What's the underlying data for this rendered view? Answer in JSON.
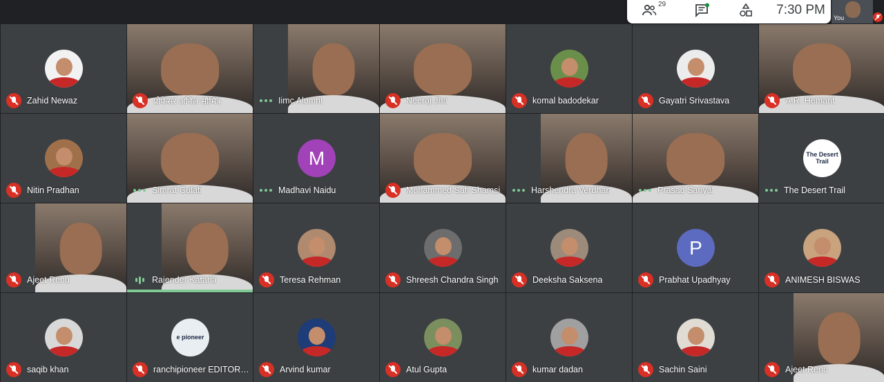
{
  "status_bar": {
    "participant_count": "29",
    "time": "7:30 PM",
    "self_label": "You"
  },
  "colors": {
    "background": "#202124",
    "tile": "#3c4043",
    "muted_red": "#d93025",
    "speaking_green": "#81c995"
  },
  "participants": [
    {
      "name": "Zahid Newaz",
      "mic": "muted",
      "kind": "avatar",
      "avatar_color": "#f2f2f2"
    },
    {
      "name": "प्रोफेसर अनिल सौमित्र",
      "mic": "muted",
      "kind": "video"
    },
    {
      "name": "Iimc Alumni",
      "mic": "connected",
      "kind": "video"
    },
    {
      "name": "Neeraj Jha",
      "mic": "muted",
      "kind": "video"
    },
    {
      "name": "komal badodekar",
      "mic": "muted",
      "kind": "avatar",
      "avatar_color": "#6a8f4a"
    },
    {
      "name": "Gayatri Srivastava",
      "mic": "muted",
      "kind": "avatar",
      "avatar_color": "#ececec"
    },
    {
      "name": "A.R. Hemant",
      "mic": "muted",
      "kind": "video"
    },
    {
      "name": "Nitin Pradhan",
      "mic": "muted",
      "kind": "avatar",
      "avatar_color": "#a0704a"
    },
    {
      "name": "Simrat Gulati",
      "mic": "connected",
      "kind": "video"
    },
    {
      "name": "Madhavi Naidu",
      "mic": "connected",
      "kind": "letter",
      "letter": "M",
      "avatar_color": "#a142b8"
    },
    {
      "name": "Mohammed Safi Shamsi",
      "mic": "muted",
      "kind": "video"
    },
    {
      "name": "Harshendra Verdhan",
      "mic": "connected",
      "kind": "video"
    },
    {
      "name": "Prasad Sanyal",
      "mic": "connected",
      "kind": "video"
    },
    {
      "name": "The Desert Trail",
      "mic": "connected",
      "kind": "avatar",
      "avatar_color": "#ffffff",
      "logo_text": "The Desert Trail"
    },
    {
      "name": "Ajeet Renu",
      "mic": "muted",
      "kind": "video"
    },
    {
      "name": "Rajender Kataria",
      "mic": "speaking",
      "kind": "video"
    },
    {
      "name": "Teresa Rehman",
      "mic": "muted",
      "kind": "avatar",
      "avatar_color": "#b08a6e"
    },
    {
      "name": "Shreesh Chandra Singh",
      "mic": "muted",
      "kind": "avatar",
      "avatar_color": "#6d6d6d"
    },
    {
      "name": "Deeksha Saksena",
      "mic": "muted",
      "kind": "avatar",
      "avatar_color": "#9c8b7a"
    },
    {
      "name": "Prabhat Upadhyay",
      "mic": "muted",
      "kind": "letter",
      "letter": "P",
      "avatar_color": "#5c6bc0"
    },
    {
      "name": "ANIMESH BISWAS",
      "mic": "muted",
      "kind": "avatar",
      "avatar_color": "#c9a27e"
    },
    {
      "name": "saqib khan",
      "mic": "muted",
      "kind": "avatar",
      "avatar_color": "#d8d8d8"
    },
    {
      "name": "ranchipioneer EDITORI…",
      "mic": "muted",
      "kind": "avatar",
      "avatar_color": "#e9eef2",
      "logo_text": "e pioneer"
    },
    {
      "name": "Arvind kumar",
      "mic": "muted",
      "kind": "avatar",
      "avatar_color": "#1d3c78"
    },
    {
      "name": "Atul Gupta",
      "mic": "muted",
      "kind": "avatar",
      "avatar_color": "#7b8f5e"
    },
    {
      "name": "kumar dadan",
      "mic": "muted",
      "kind": "avatar",
      "avatar_color": "#a0a0a0"
    },
    {
      "name": "Sachin Saini",
      "mic": "muted",
      "kind": "avatar",
      "avatar_color": "#e0dcd4"
    },
    {
      "name": "Ajeet Renu",
      "mic": "muted",
      "kind": "video"
    }
  ]
}
